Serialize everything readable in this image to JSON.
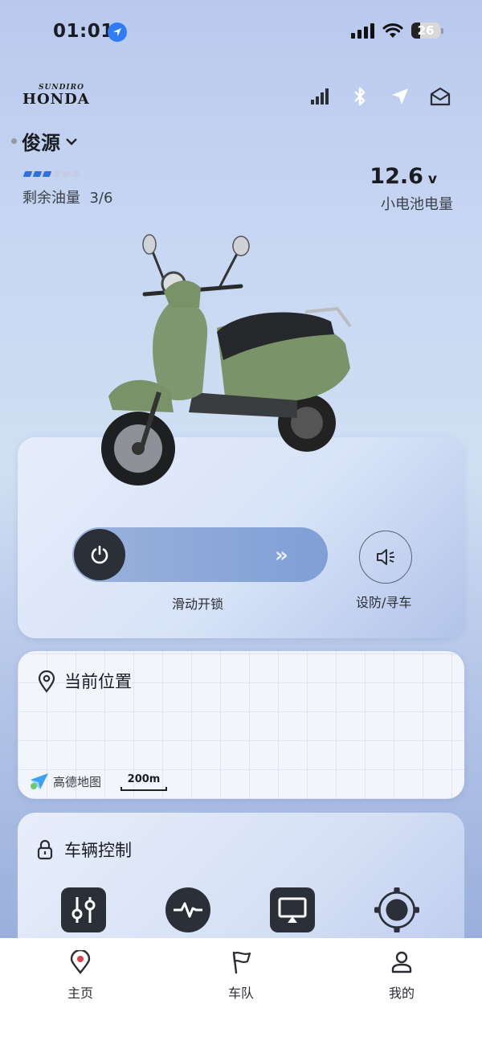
{
  "status_bar": {
    "time": "01:01",
    "battery": "26",
    "icons": [
      "location-arrow-icon",
      "cellular-signal-icon",
      "wifi-icon",
      "battery-icon"
    ]
  },
  "header": {
    "brand_small": "SUNDIRO",
    "brand_large": "HONDA",
    "icons": [
      "signal-strength-icon",
      "bluetooth-icon",
      "navigation-icon",
      "mail-icon"
    ]
  },
  "vehicle": {
    "name": "俊源",
    "fuel_label": "剩余油量",
    "fuel_value": "3/6",
    "fuel_level_fraction": 0.5,
    "fuel_bar_active_color": "#2f6fe0",
    "fuel_bar_inactive_color": "#c3cee6",
    "voltage_value": "12.6",
    "voltage_unit": "v",
    "voltage_label": "小电池电量"
  },
  "unlock_card": {
    "slider_label": "滑动开锁",
    "slider_arrow": "»",
    "alarm_label": "设防/寻车"
  },
  "map_card": {
    "title": "当前位置",
    "provider": "高德地图",
    "scale": "200m"
  },
  "control_card": {
    "title": "车辆控制",
    "controls": [
      "sliders-icon",
      "pulse-icon",
      "screen-cast-icon",
      "target-icon"
    ]
  },
  "tabbar": {
    "tabs": [
      {
        "label": "主页",
        "icon": "location-pin-icon",
        "active": true
      },
      {
        "label": "车队",
        "icon": "flag-icon",
        "active": false
      },
      {
        "label": "我的",
        "icon": "user-icon",
        "active": false
      }
    ]
  },
  "colors": {
    "accent_red": "#e0414a",
    "dark_button": "#2b2f38",
    "fuel_blue": "#2f6fe0"
  }
}
